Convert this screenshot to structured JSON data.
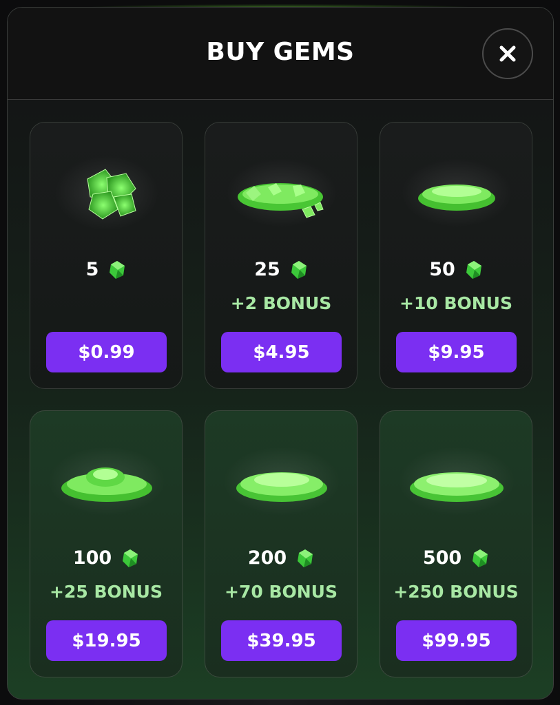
{
  "modal": {
    "title": "BUY GEMS",
    "close_icon": "close-icon"
  },
  "colors": {
    "accent_purple": "#7b2ff2",
    "bonus_green": "#a8e8a4",
    "gem_green": "#5fe04a"
  },
  "packs": [
    {
      "amount": "5",
      "bonus": "",
      "price": "$0.99",
      "icon": "gem-icon"
    },
    {
      "amount": "25",
      "bonus": "+2 BONUS",
      "price": "$4.95",
      "icon": "gem-icon"
    },
    {
      "amount": "50",
      "bonus": "+10 BONUS",
      "price": "$9.95",
      "icon": "gem-icon"
    },
    {
      "amount": "100",
      "bonus": "+25 BONUS",
      "price": "$19.95",
      "icon": "gem-icon"
    },
    {
      "amount": "200",
      "bonus": "+70 BONUS",
      "price": "$39.95",
      "icon": "gem-icon"
    },
    {
      "amount": "500",
      "bonus": "+250 BONUS",
      "price": "$99.95",
      "icon": "gem-icon"
    }
  ]
}
